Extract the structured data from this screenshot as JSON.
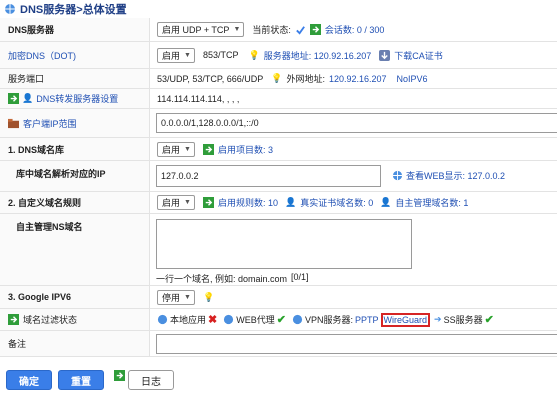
{
  "page_title": "DNS服务器>总体设置",
  "rows": {
    "dns_server": {
      "label": "DNS服务器",
      "select": "启用 UDP + TCP",
      "status_label": "当前状态:",
      "sessions": "会话数: 0 / 300"
    },
    "encrypted_dns": {
      "label": "加密DNS（DOT)",
      "select": "启用",
      "port": "853/TCP",
      "server_addr": "服务器地址: 120.92.16.207",
      "download_ca": "下载CA证书"
    },
    "port": {
      "label": "服务端口",
      "ports": "53/UDP, 53/TCP, 666/UDP",
      "external_addr_label": "外网地址:",
      "external_addr": "120.92.16.207",
      "no_ipv6": "NoIPV6"
    },
    "forward": {
      "label": "DNS转发服务器设置",
      "value": "114.114.114.114, , , ,"
    },
    "client_ip": {
      "label": "客户端IP范围",
      "value": "0.0.0.0/1,128.0.0.0/1,::/0"
    },
    "domain_lib": {
      "label": "1. DNS域名库",
      "select": "启用",
      "enabled_items": "启用项目数: 3"
    },
    "resolve_ip": {
      "label": "库中域名解析对应的IP",
      "value": "127.0.0.2",
      "web_display": "查看WEB显示: 127.0.0.2"
    },
    "custom_rules": {
      "label": "2. 自定义域名规则",
      "select": "启用",
      "rules_count": "启用规则数: 10",
      "real_cert": "真实证书域名数: 0",
      "self_managed_count": "自主管理域名数: 1"
    },
    "self_ns": {
      "label": "自主管理NS域名",
      "hint": "一行一个域名, 例如: domain.com",
      "counter": "[0/1]"
    },
    "google_ipv6": {
      "label": "3. Google IPV6",
      "select": "停用"
    },
    "filter_status": {
      "label": "域名过滤状态",
      "local_app": "本地应用",
      "web_proxy": "WEB代理",
      "vpn_label": "VPN服务器:",
      "pptp": "PPTP",
      "wireguard": "WireGuard",
      "ss_server": "SS服务器"
    },
    "remark": {
      "label": "备注"
    }
  },
  "buttons": {
    "ok": "确定",
    "reset": "重置",
    "log": "日志"
  },
  "colors": {
    "link_blue": "#1f4fb3",
    "primary_button": "#3a7ee8",
    "ok_green": "#27a22a",
    "error_red": "#d72020",
    "highlight_red": "#d62424"
  }
}
